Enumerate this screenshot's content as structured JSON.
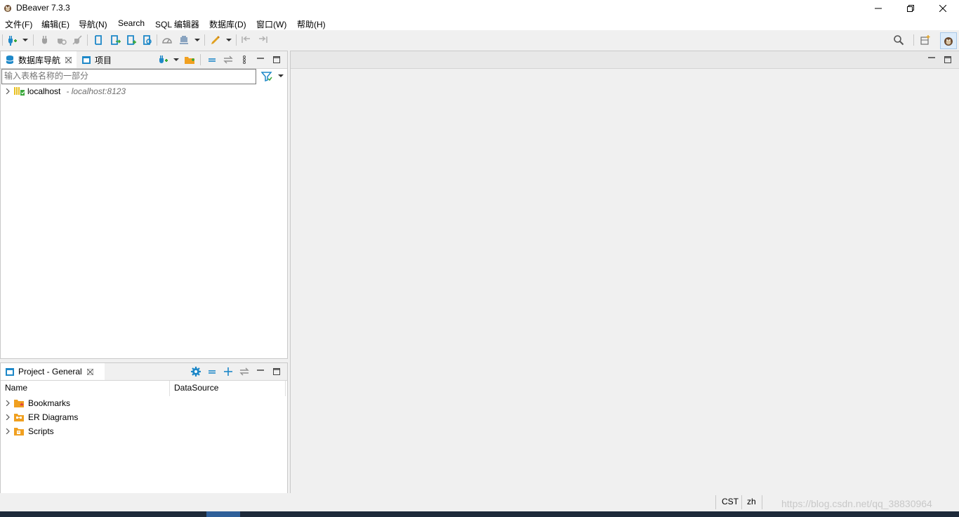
{
  "window": {
    "title": "DBeaver 7.3.3"
  },
  "menu": [
    "文件(F)",
    "编辑(E)",
    "导航(N)",
    "Search",
    "SQL 编辑器",
    "数据库(D)",
    "窗口(W)",
    "帮助(H)"
  ],
  "navigator": {
    "tab_label": "数据库导航",
    "projects_tab_label": "项目",
    "filter_placeholder": "输入表格名称的一部分",
    "connection": {
      "name": "localhost",
      "detail": "- localhost:8123"
    }
  },
  "project_panel": {
    "tab_label": "Project - General",
    "columns": [
      "Name",
      "DataSource"
    ],
    "items": [
      "Bookmarks",
      "ER Diagrams",
      "Scripts"
    ]
  },
  "status": {
    "timezone": "CST",
    "locale": "zh"
  },
  "watermark": "https://blog.csdn.net/qq_38830964",
  "colors": {
    "accent": "#1e88c8",
    "folder": "#f0a020",
    "green": "#3aa83a"
  }
}
